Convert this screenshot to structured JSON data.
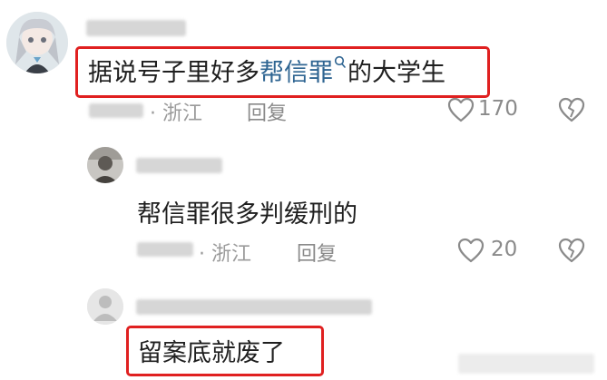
{
  "comments": [
    {
      "text_plain": "据说号子里好多",
      "text_keyword": "帮信罪",
      "text_tail": "的大学生",
      "location": "· 浙江",
      "reply_label": "回复",
      "likes": "170"
    },
    {
      "text": "帮信罪很多判缓刑的",
      "location": "· 浙江",
      "reply_label": "回复",
      "likes": "20"
    },
    {
      "text": "留案底就废了"
    }
  ],
  "icons": {
    "search": "search-icon",
    "like": "heart-outline-icon",
    "dislike": "broken-heart-icon",
    "avatar_default": "default-user-avatar-icon"
  },
  "colors": {
    "highlight_border": "#e02020",
    "keyword": "#2f6592",
    "meta_text": "#9b9b9b"
  }
}
